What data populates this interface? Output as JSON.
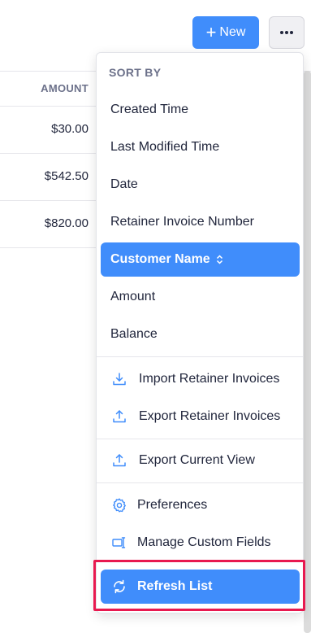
{
  "toolbar": {
    "new_label": "New",
    "plus_glyph": "+",
    "more_glyph": "•••"
  },
  "table": {
    "column_header": "AMOUNT",
    "amounts": [
      "$30.00",
      "$542.50",
      "$820.00"
    ]
  },
  "menu": {
    "heading": "SORT BY",
    "sort_options": [
      "Created Time",
      "Last Modified Time",
      "Date",
      "Retainer Invoice Number",
      "Customer Name",
      "Amount",
      "Balance"
    ],
    "active_sort": "Customer Name",
    "sort_indicator": "⌃⌄",
    "import_label": "Import Retainer Invoices",
    "export_label": "Export Retainer Invoices",
    "export_view_label": "Export Current View",
    "preferences_label": "Preferences",
    "custom_fields_label": "Manage Custom Fields",
    "refresh_label": "Refresh List"
  },
  "colors": {
    "accent": "#408dfb",
    "icon": "#408dfb",
    "highlight": "#e8194f"
  }
}
